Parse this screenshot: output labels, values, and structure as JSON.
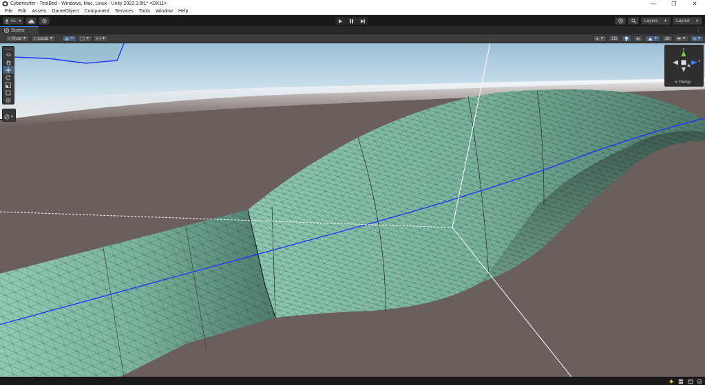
{
  "window": {
    "title": "Cybersurfer - TestBed - Windows, Mac, Linux - Unity 2022.3.5f1* <DX11>",
    "minimize": "—",
    "maximize": "❐",
    "close": "✕"
  },
  "menu": [
    "File",
    "Edit",
    "Assets",
    "GameObject",
    "Component",
    "Services",
    "Tools",
    "Window",
    "Help"
  ],
  "toolbar": {
    "account_label": "AL",
    "layers_label": "Layers",
    "layout_label": "Layout"
  },
  "scene_tab": {
    "label": "Scene"
  },
  "scene_toolbar": {
    "pivot_label": "Pivot",
    "local_label": "Local",
    "mode_2d_label": "2D"
  },
  "gizmo": {
    "persp_label": "Persp",
    "y_label": "y",
    "z_label": "z"
  },
  "colors": {
    "editor_dark": "#191919",
    "panel": "#3c3c3c",
    "accent_blue": "#3a7ce2",
    "ground": "#6b5f5d",
    "mesh_fill": "#8fc8b2",
    "spline": "#1a33ff"
  }
}
